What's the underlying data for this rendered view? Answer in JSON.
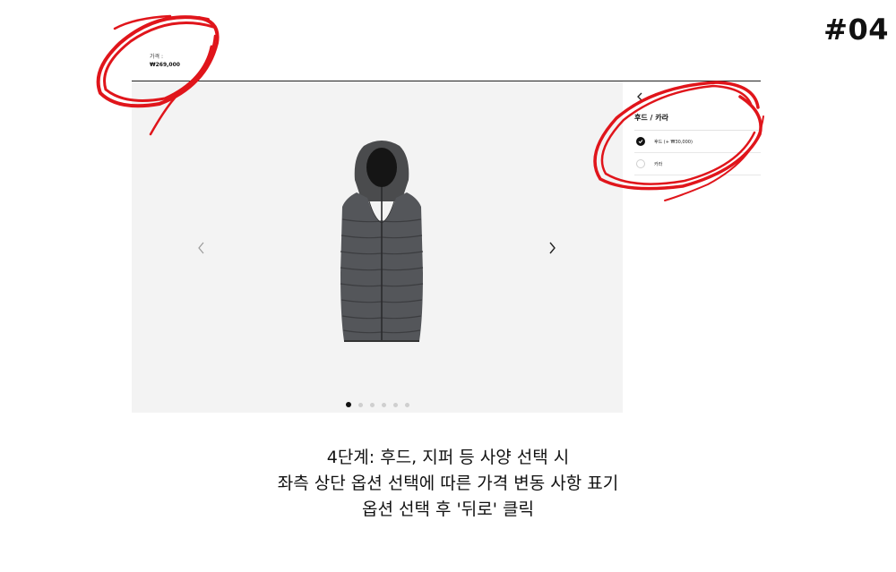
{
  "step_badge": "#04",
  "price": {
    "label": "가격 :",
    "value": "₩269,000"
  },
  "options": {
    "title": "후드 / 카라",
    "items": [
      {
        "label": "후드 (+ ₩30,000)",
        "selected": true
      },
      {
        "label": "카라",
        "selected": false
      }
    ]
  },
  "gallery": {
    "image_icon": "hooded-puffer-vest-icon",
    "dot_count": 6,
    "active_dot": 1
  },
  "icons": {
    "back": "chevron-left-icon",
    "prev": "chevron-left-icon",
    "next": "chevron-right-icon"
  },
  "caption": {
    "line1": "4단계: 후드, 지퍼 등 사양 선택 시",
    "line2": "좌측 상단 옵션 선택에 따른 가격 변동 사항 표기",
    "line3": "옵션 선택 후 '뒤로' 클릭"
  },
  "colors": {
    "annotation": "#e0151b",
    "gallery_bg": "#f3f3f3",
    "text": "#111111"
  }
}
